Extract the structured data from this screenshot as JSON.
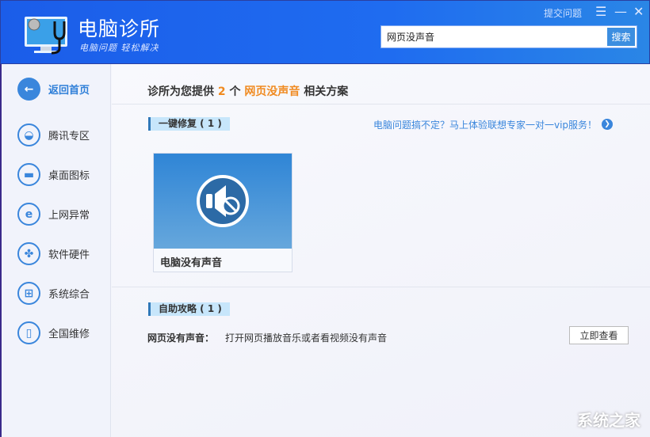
{
  "header": {
    "title": "电脑诊所",
    "subtitle": "电脑问题 轻松解决",
    "submit": "提交问题",
    "menu_icon": "menu-icon",
    "min_icon": "minimize-icon",
    "close_icon": "close-icon"
  },
  "search": {
    "value": "网页没声音",
    "button": "搜索"
  },
  "sidebar": {
    "items": [
      {
        "label": "返回首页",
        "icon": "back-arrow-icon",
        "glyph": "←"
      },
      {
        "label": "腾讯专区",
        "icon": "qq-icon",
        "glyph": "◒"
      },
      {
        "label": "桌面图标",
        "icon": "monitor-icon",
        "glyph": "▬"
      },
      {
        "label": "上网异常",
        "icon": "ie-icon",
        "glyph": "e"
      },
      {
        "label": "软件硬件",
        "icon": "clover-icon",
        "glyph": "✤"
      },
      {
        "label": "系统综合",
        "icon": "windows-icon",
        "glyph": "⊞"
      },
      {
        "label": "全国维修",
        "icon": "pc-tower-icon",
        "glyph": "▯"
      }
    ]
  },
  "main": {
    "heading_pre": "诊所为您提供",
    "count": "2",
    "heading_mid": "个",
    "keyword": "网页没声音",
    "heading_post": "相关方案",
    "section1": "一键修复 ( 1 )",
    "promo": "电脑问题搞不定？马上体验联想专家一对一vip服务！",
    "card_label": "电脑没有声音",
    "section2": "自助攻略 ( 1 )",
    "row_title": "网页没有声音：",
    "row_desc": "打开网页播放音乐或者看视频没有声音",
    "view_button": "立即查看"
  },
  "watermark": "系统之家"
}
